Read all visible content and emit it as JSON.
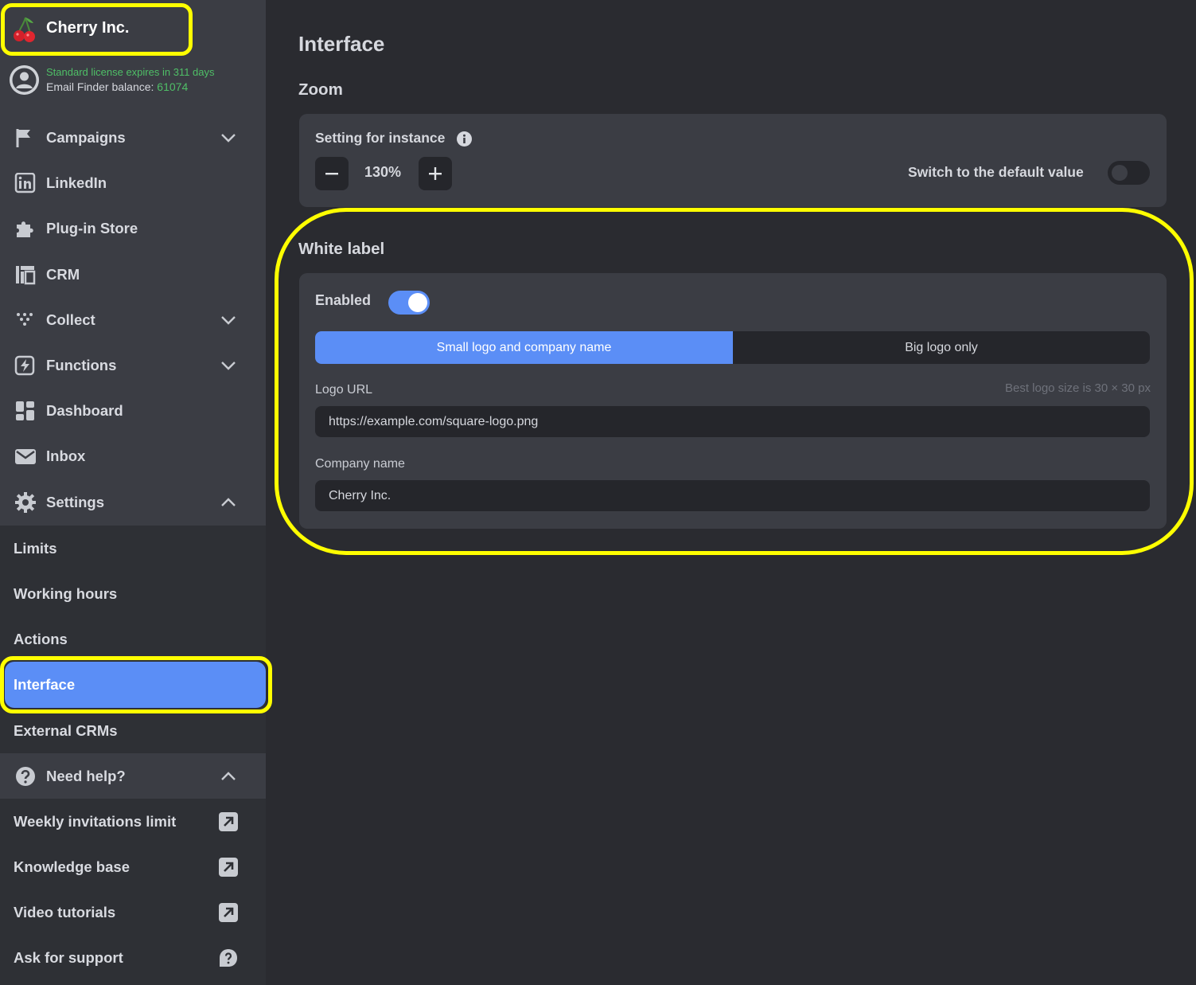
{
  "brand": {
    "name": "Cherry Inc."
  },
  "license": {
    "status": "Standard license expires in 311 days",
    "balance_label": "Email Finder balance:",
    "balance_value": "61074"
  },
  "nav": {
    "campaigns": "Campaigns",
    "linkedin": "LinkedIn",
    "plugin_store": "Plug-in Store",
    "crm": "CRM",
    "collect": "Collect",
    "functions": "Functions",
    "dashboard": "Dashboard",
    "inbox": "Inbox",
    "settings": "Settings"
  },
  "settings_sub": {
    "limits": "Limits",
    "working_hours": "Working hours",
    "actions": "Actions",
    "interface": "Interface",
    "external_crms": "External CRMs"
  },
  "help": {
    "title": "Need help?",
    "weekly": "Weekly invitations limit",
    "knowledge": "Knowledge base",
    "video": "Video tutorials",
    "support": "Ask for support"
  },
  "page": {
    "title": "Interface",
    "zoom": {
      "title": "Zoom",
      "setting_label": "Setting for instance",
      "value": "130%",
      "switch_label": "Switch to the default value",
      "default_enabled": false
    },
    "white_label": {
      "title": "White label",
      "enabled_label": "Enabled",
      "enabled": true,
      "options": [
        "Small logo and company name",
        "Big logo only"
      ],
      "selected_option": "Small logo and company name",
      "logo_url_label": "Logo URL",
      "logo_hint": "Best logo size is 30 × 30 px",
      "logo_url_value": "https://example.com/square-logo.png",
      "company_label": "Company name",
      "company_value": "Cherry Inc."
    }
  },
  "colors": {
    "accent": "#5b8ef6",
    "highlight": "#ffff00",
    "license_green": "#4fbf67",
    "sidebar_bg": "#3b3d44",
    "main_bg": "#2a2b30"
  },
  "icons": [
    "cherry-icon",
    "avatar-icon",
    "flag-icon",
    "linkedin-icon",
    "puzzle-icon",
    "crm-icon",
    "collect-icon",
    "functions-icon",
    "dashboard-icon",
    "mail-icon",
    "gear-icon",
    "help-icon",
    "external-link-icon",
    "chat-question-icon",
    "info-icon",
    "minus-icon",
    "plus-icon",
    "chevron-down-icon",
    "chevron-up-icon"
  ]
}
